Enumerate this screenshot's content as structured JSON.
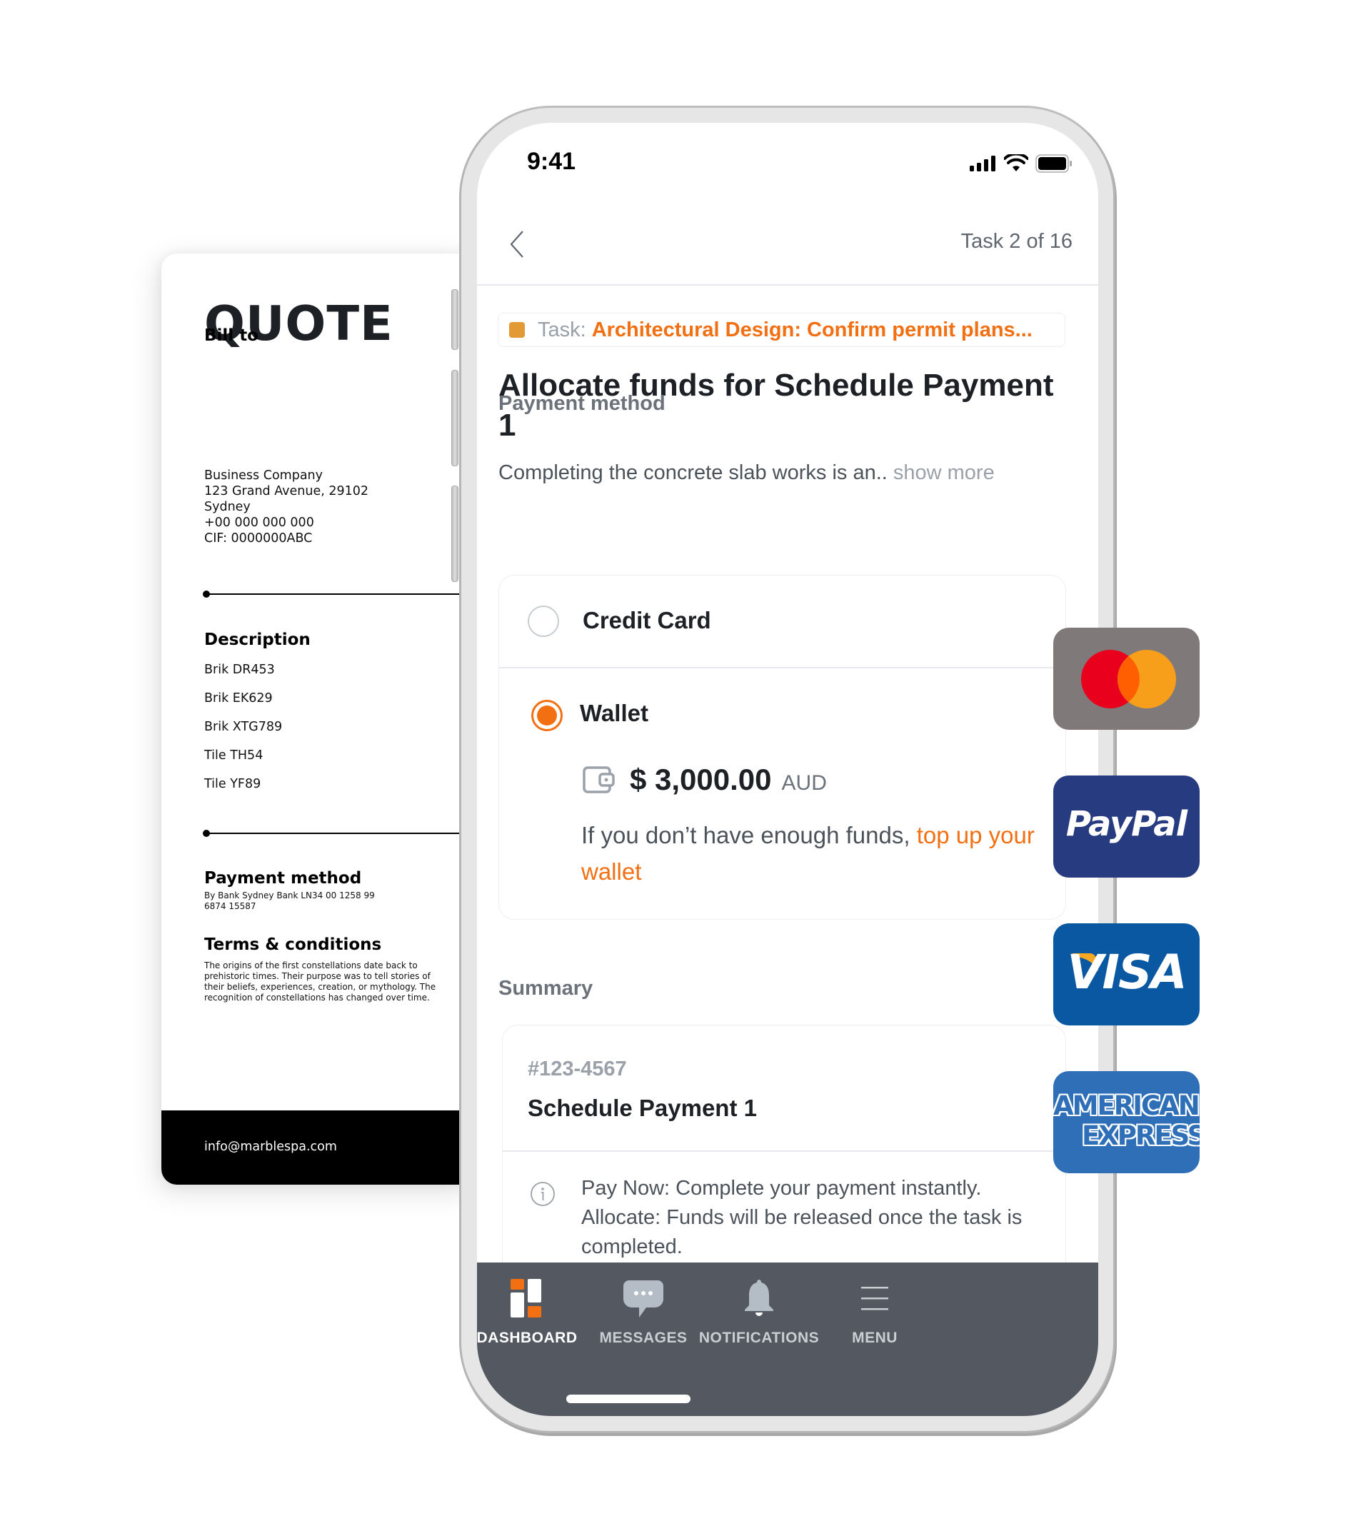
{
  "quote": {
    "title": "QUOTE",
    "bill_to": {
      "heading": "Bill to",
      "lines": [
        "Business Company",
        "123 Grand Avenue, 29102",
        "Sydney",
        "+00 000 000 000",
        "CIF: 0000000ABC"
      ]
    },
    "description": {
      "heading": "Description",
      "items": [
        "Brik DR453",
        "Brik EK629",
        "Brik XTG789",
        "Tile TH54",
        "Tile YF89"
      ]
    },
    "payment_method": {
      "heading": "Payment method",
      "text": "By Bank Sydney Bank LN34 00 1258 99 6874 15587"
    },
    "terms": {
      "heading": "Terms & conditions",
      "text": "The origins of the first constellations date back to prehistoric times. Their purpose was to tell stories of their beliefs, experiences, creation, or mythology. The recognition of constellations has changed over time."
    },
    "footer_email": "info@marblespa.com"
  },
  "phone": {
    "status_bar": {
      "time": "9:41",
      "icons": [
        "signal-icon",
        "wifi-icon",
        "battery-icon"
      ]
    },
    "header": {
      "back_icon": "chevron-left-icon",
      "task_counter": "Task 2 of 16"
    },
    "task_chip": {
      "label": "Task:",
      "value": "Architectural Design: Confirm permit plans..."
    },
    "title": "Allocate funds for Schedule Payment 1",
    "description": {
      "text": "Completing the concrete slab works is an..",
      "more_link": "show more"
    },
    "payment_method": {
      "label": "Payment method",
      "options": [
        {
          "label": "Credit Card",
          "selected": false
        },
        {
          "label": "Wallet",
          "selected": true
        }
      ],
      "wallet": {
        "amount": "$ 3,000.00",
        "currency": "AUD",
        "note": "If you don’t have enough funds,",
        "note_link": "top up your wallet"
      }
    },
    "summary": {
      "label": "Summary",
      "id": "#123-4567",
      "name": "Schedule Payment 1",
      "info": "Pay Now: Complete your payment instantly. Allocate: Funds will be released once the task is completed."
    },
    "nav": [
      {
        "label": "DASHBOARD",
        "icon": "dashboard-icon",
        "active": true
      },
      {
        "label": "MESSAGES",
        "icon": "chat-bubble-icon",
        "active": false
      },
      {
        "label": "NOTIFICATIONS",
        "icon": "bell-icon",
        "active": false
      },
      {
        "label": "MENU",
        "icon": "hamburger-menu-icon",
        "active": false
      }
    ]
  },
  "brands": [
    {
      "name": "Mastercard",
      "icon": "mastercard-icon",
      "color": "#7f7979"
    },
    {
      "name": "PayPal",
      "icon": "paypal-icon",
      "color": "#263b80"
    },
    {
      "name": "VISA",
      "icon": "visa-icon",
      "color": "#0a57a2"
    },
    {
      "name": "AMERICAN EXPRESS",
      "line1": "AMERICAN",
      "line2": "EXPRESS",
      "icon": "amex-icon",
      "color": "#2e6fb7"
    }
  ],
  "colors": {
    "accent": "#f26f12",
    "task_square": "#e39a34",
    "nav_bg": "#545961",
    "text_dark": "#1d2025",
    "text_muted": "#6b727a"
  }
}
